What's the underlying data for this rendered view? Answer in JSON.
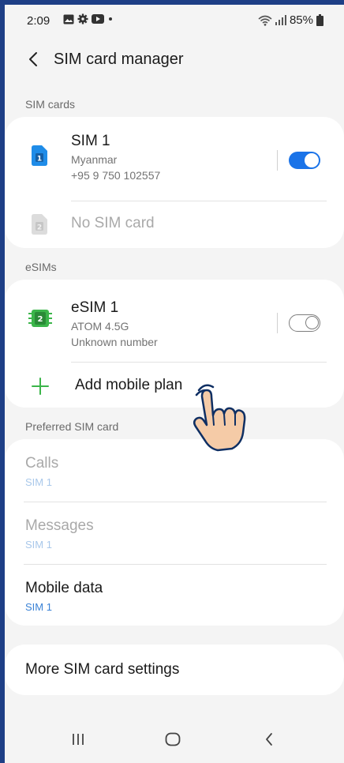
{
  "status_bar": {
    "time": "2:09",
    "battery": "85%"
  },
  "header": {
    "title": "SIM card manager"
  },
  "sections": {
    "sim_cards": "SIM cards",
    "esims": "eSIMs",
    "preferred": "Preferred SIM card"
  },
  "sim_cards": [
    {
      "badge": "1",
      "name": "SIM 1",
      "carrier": "Myanmar",
      "number": "+95 9 750 102557",
      "enabled": true
    },
    {
      "badge": "2",
      "name": "No SIM card"
    }
  ],
  "esims": [
    {
      "badge": "2",
      "name": "eSIM 1",
      "carrier": "ATOM 4.5G",
      "number": "Unknown number",
      "enabled": false
    }
  ],
  "add_plan": {
    "label": "Add mobile plan"
  },
  "preferred": [
    {
      "title": "Calls",
      "value": "SIM 1",
      "enabled": false
    },
    {
      "title": "Messages",
      "value": "SIM 1",
      "enabled": false
    },
    {
      "title": "Mobile data",
      "value": "SIM 1",
      "enabled": true
    }
  ],
  "more_settings": {
    "label": "More SIM card settings"
  },
  "colors": {
    "accent": "#1a73e8",
    "sim_blue": "#1f8ce8",
    "esim_green": "#3bb54a",
    "background": "#f4f4f4"
  }
}
